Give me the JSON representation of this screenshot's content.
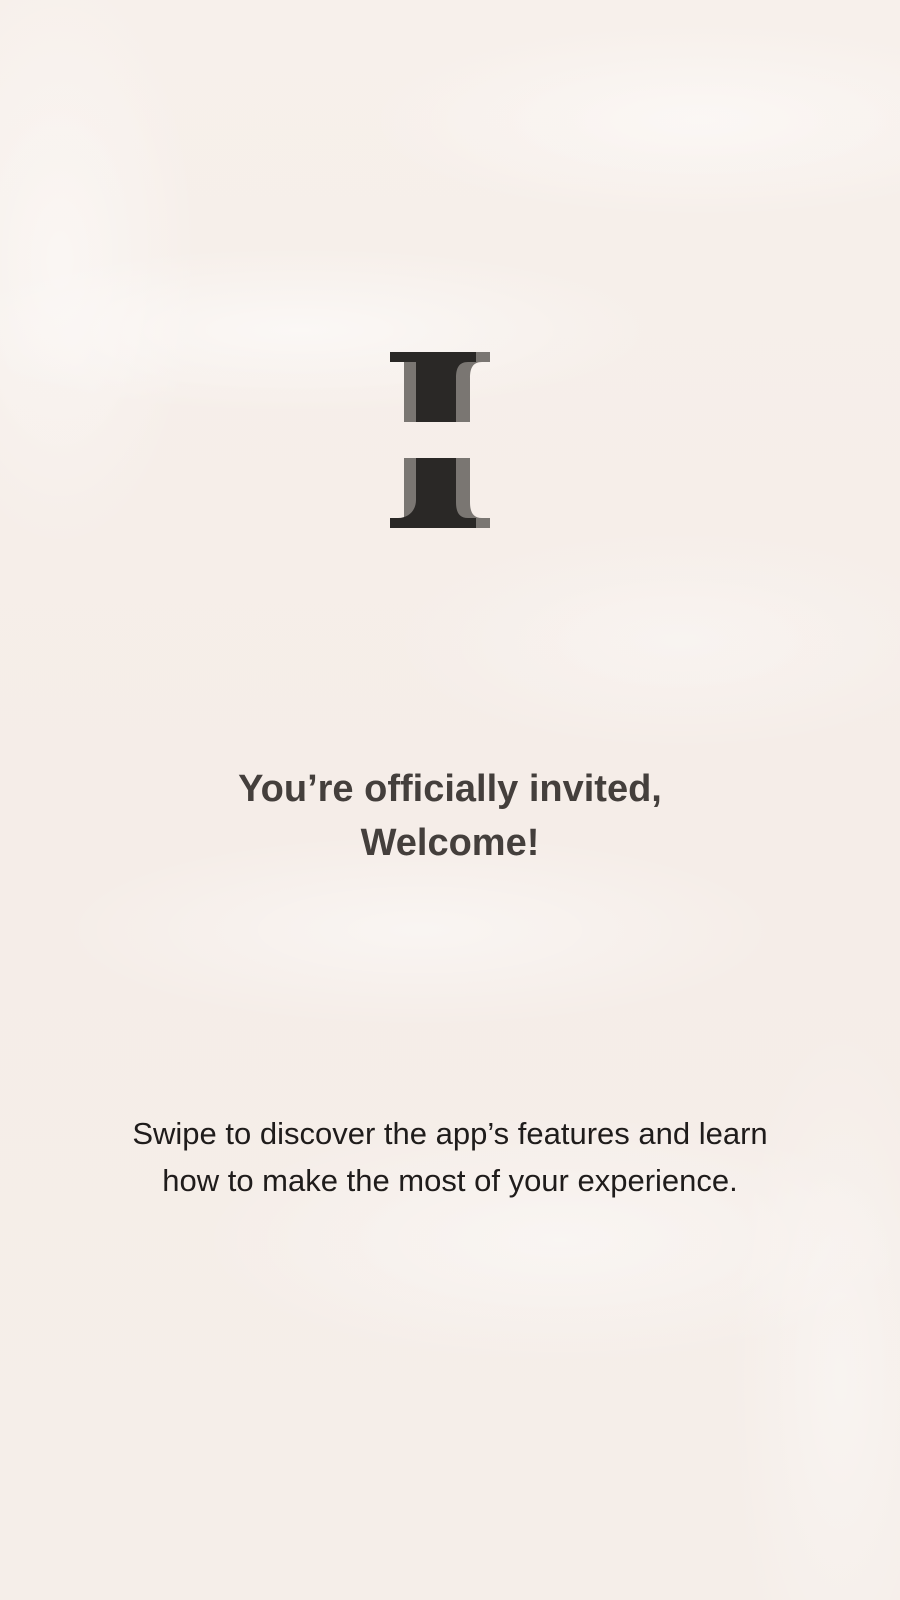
{
  "logo": {
    "icon": "stacked-serif-i-logo-icon",
    "primary_color": "#2a2826",
    "shadow_color": "#7a7672"
  },
  "welcome": {
    "line1": "You’re officially invited,",
    "line2": "Welcome!"
  },
  "description": {
    "line1": "Swipe to discover the app’s features and learn",
    "line2": "how to make the most of your experience."
  },
  "colors": {
    "background": "#f6efea",
    "heading": "#443f3c",
    "body_text": "#1f1c1b"
  }
}
